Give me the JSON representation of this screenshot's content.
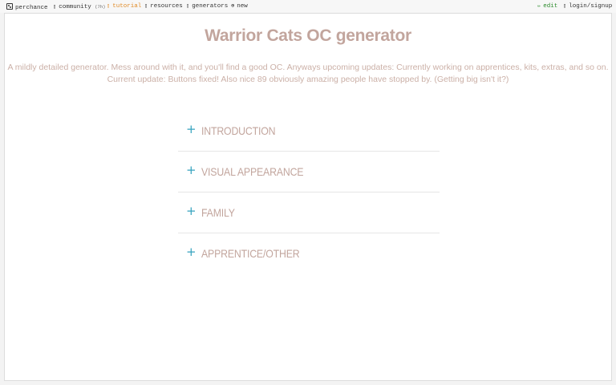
{
  "topbar": {
    "brand": "perchance",
    "community": "community",
    "community_badge": "(7h)",
    "tutorial": "tutorial",
    "resources": "resources",
    "generators": "generators",
    "new": "new",
    "edit": "edit",
    "login": "login/signup"
  },
  "page": {
    "title": "Warrior Cats OC generator",
    "description_line1": "A mildly detailed generator. Mess around with it, and you'll find a good OC. Anyways upcoming updates: Currently working on apprentices, kits, extras, and so on.",
    "description_line2": "Current update: Buttons fixed! Also nice 89 obviously amazing people have stopped by. (Getting big isn't it?)"
  },
  "accordion": [
    {
      "label": "INTRODUCTION",
      "icon": "plus-icon"
    },
    {
      "label": "VISUAL APPEARANCE",
      "icon": "plus-icon"
    },
    {
      "label": "FAMILY",
      "icon": "plus-icon"
    },
    {
      "label": "APPRENTICE/OTHER",
      "icon": "plus-icon"
    }
  ],
  "colors": {
    "title": "#c2a59d",
    "accent_plus": "#36a3bf",
    "tutorial": "#e08a26",
    "edit": "#2a8a2a"
  }
}
